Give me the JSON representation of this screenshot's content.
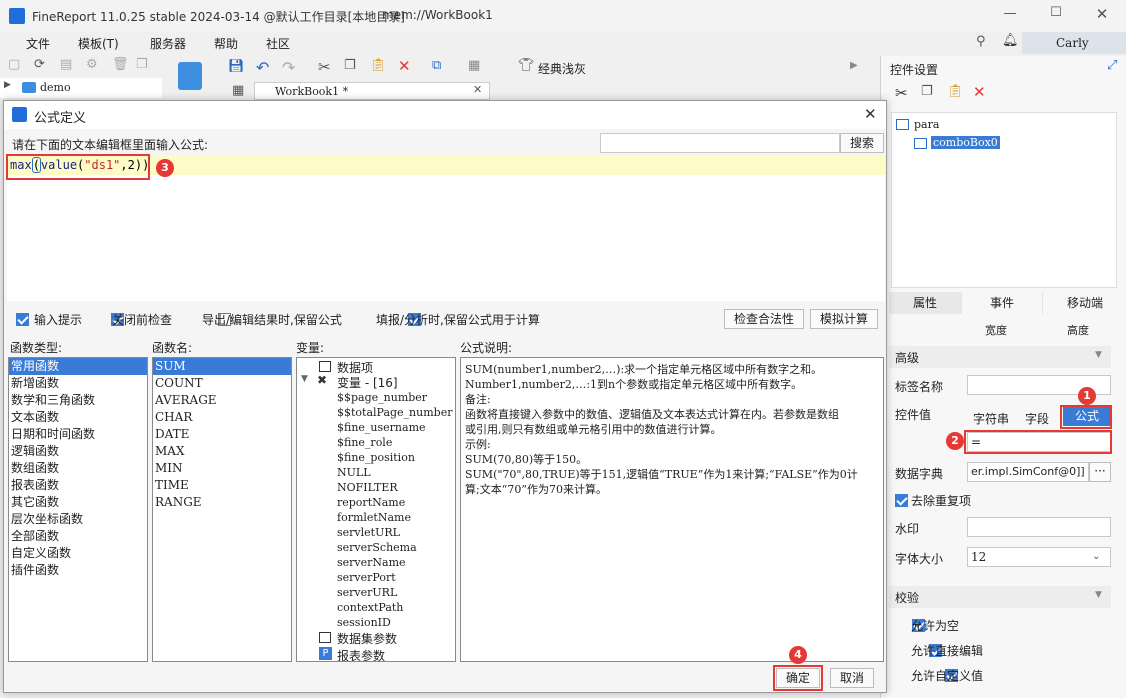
{
  "app": {
    "title": "FineReport 11.0.25 stable 2024-03-14 @默认工作目录[本地目录]",
    "path": "mem://WorkBook1",
    "user": "Carly"
  },
  "menu": [
    "文件",
    "模板(T)",
    "服务器",
    "帮助",
    "社区"
  ],
  "toolbar": {
    "theme_label": "经典浅灰",
    "tab_label": "WorkBook1 *"
  },
  "tree": {
    "root": "demo"
  },
  "right_panel": {
    "title": "控件设置",
    "tree_root": "para",
    "tree_child": "comboBox0",
    "tabs": [
      "属性",
      "事件",
      "移动端"
    ],
    "subheaders": [
      "宽度",
      "高度"
    ],
    "section_advanced": "高级",
    "label_name": "标签名称",
    "widget_value": "控件值",
    "value_types": [
      "字符串",
      "字段",
      "公式"
    ],
    "formula_value": "=",
    "dict_label": "数据字典",
    "dict_value": "er.impl.SimConf@0]]",
    "dict_more": "···",
    "dedup": "去除重复项",
    "watermark": "水印",
    "font_size_label": "字体大小",
    "font_size_value": "12",
    "section_validate": "校验",
    "allow_empty": "允许为空",
    "allow_edit": "允许直接编辑",
    "allow_custom": "允许自定义值"
  },
  "dialog": {
    "title": "公式定义",
    "prompt": "请在下面的文本编辑框里面输入公式:",
    "search_btn": "搜索",
    "formula_fn1": "max",
    "formula_fn2": "value",
    "formula_str": "\"ds1\"",
    "formula_rest": ",2))",
    "opt_hint": "输入提示",
    "opt_check": "关闭前检查",
    "opt_export": "导出/编辑结果时,保留公式",
    "opt_fill": "填报/分析时,保留公式用于计算",
    "btn_validate": "检查合法性",
    "btn_simulate": "模拟计算",
    "col_type": "函数类型:",
    "col_name": "函数名:",
    "col_var": "变量:",
    "col_desc": "公式说明:",
    "func_types": [
      "常用函数",
      "新增函数",
      "数学和三角函数",
      "文本函数",
      "日期和时间函数",
      "逻辑函数",
      "数组函数",
      "报表函数",
      "其它函数",
      "层次坐标函数",
      "全部函数",
      "自定义函数",
      "插件函数"
    ],
    "func_names": [
      "SUM",
      "COUNT",
      "AVERAGE",
      "CHAR",
      "DATE",
      "MAX",
      "MIN",
      "TIME",
      "RANGE"
    ],
    "var_dataitem": "数据项",
    "var_group": "变量 - [16]",
    "variables": [
      "$$page_number",
      "$$totalPage_number",
      "$fine_username",
      "$fine_role",
      "$fine_position",
      "NULL",
      "NOFILTER",
      "reportName",
      "formletName",
      "servletURL",
      "serverSchema",
      "serverName",
      "serverPort",
      "serverURL",
      "contextPath",
      "sessionID"
    ],
    "var_dataset": "数据集参数",
    "var_report": "报表参数",
    "desc_lines": [
      "SUM(number1,number2,…):求一个指定单元格区域中所有数字之和。",
      "Number1,number2,…:1到n个参数或指定单元格区域中所有数字。",
      "备注:",
      "函数将直接键入参数中的数值、逻辑值及文本表达式计算在内。若参数是数组",
      "或引用,则只有数组或单元格引用中的数值进行计算。",
      "示例:",
      "SUM(70,80)等于150。",
      "SUM(\"70\",80,TRUE)等于151,逻辑值“TRUE”作为1来计算;“FALSE”作为0计",
      "算;文本“70”作为70来计算。"
    ],
    "ok": "确定",
    "cancel": "取消"
  },
  "markers": [
    "1",
    "2",
    "3",
    "4"
  ]
}
